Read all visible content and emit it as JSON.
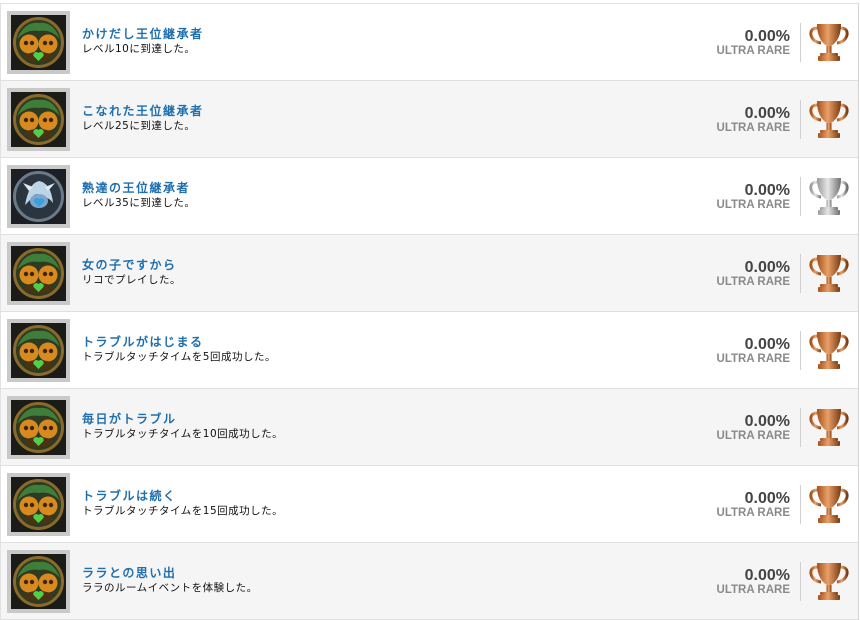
{
  "rarity_label": "ULTRA RARE",
  "colors": {
    "title": "#1f6fae",
    "bronze": "#c06a2b",
    "silver": "#b8b8b8"
  },
  "trophies": [
    {
      "title": "かけだし王位継承者",
      "description": "レベル10に到達した。",
      "percent": "0.00%",
      "grade": "bronze",
      "icon": "twin-character-icon"
    },
    {
      "title": "こなれた王位継承者",
      "description": "レベル25に到達した。",
      "percent": "0.00%",
      "grade": "bronze",
      "icon": "twin-character-icon"
    },
    {
      "title": "熟達の王位継承者",
      "description": "レベル35に到達した。",
      "percent": "0.00%",
      "grade": "silver",
      "icon": "silver-character-icon"
    },
    {
      "title": "女の子ですから",
      "description": "リコでプレイした。",
      "percent": "0.00%",
      "grade": "bronze",
      "icon": "twin-character-icon"
    },
    {
      "title": "トラブルがはじまる",
      "description": "トラブルタッチタイムを5回成功した。",
      "percent": "0.00%",
      "grade": "bronze",
      "icon": "twin-character-icon"
    },
    {
      "title": "毎日がトラブル",
      "description": "トラブルタッチタイムを10回成功した。",
      "percent": "0.00%",
      "grade": "bronze",
      "icon": "twin-character-icon"
    },
    {
      "title": "トラブルは続く",
      "description": "トラブルタッチタイムを15回成功した。",
      "percent": "0.00%",
      "grade": "bronze",
      "icon": "twin-character-icon"
    },
    {
      "title": "ララとの思い出",
      "description": "ララのルームイベントを体験した。",
      "percent": "0.00%",
      "grade": "bronze",
      "icon": "twin-character-icon"
    }
  ]
}
